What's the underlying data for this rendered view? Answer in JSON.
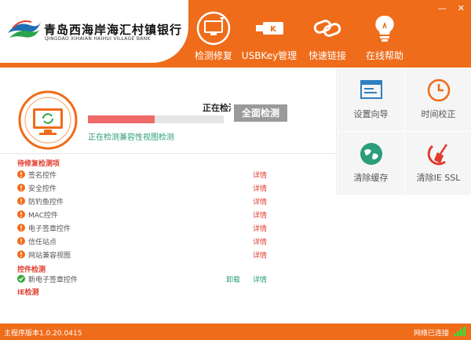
{
  "app": {
    "bank_name_cn": "青岛西海岸海汇村镇银行",
    "bank_name_en": "QINGDAO XIHAIAN HAIHUI VILLAGE BANK",
    "accent_color": "#ef6c1a"
  },
  "window_controls": {
    "minimize": "—",
    "close": "✕"
  },
  "nav": [
    {
      "label": "检测修复",
      "icon": "monitor-refresh-icon"
    },
    {
      "label": "USBKey管理",
      "icon": "usb-key-icon"
    },
    {
      "label": "快速链接",
      "icon": "link-icon"
    },
    {
      "label": "在线帮助",
      "icon": "lightbulb-icon"
    }
  ],
  "scan": {
    "title": "正在检测中",
    "button_label": "全面检测",
    "status": "正在检测兼容性视图检测",
    "progress": 0.49
  },
  "sections": {
    "pending": "待修复检测项",
    "controls": "控件检测",
    "ie": "IE检测"
  },
  "pending_items": [
    {
      "label": "签名控件",
      "action": "详情"
    },
    {
      "label": "安全控件",
      "action": "详情"
    },
    {
      "label": "防钓鱼控件",
      "action": "详情"
    },
    {
      "label": "MAC控件",
      "action": "详情"
    },
    {
      "label": "电子签章控件",
      "action": "详情"
    },
    {
      "label": "信任站点",
      "action": "详情"
    },
    {
      "label": "网站兼容视图",
      "action": "详情"
    }
  ],
  "control_items": [
    {
      "label": "新电子签章控件",
      "action_uninstall": "卸载",
      "action": "详情"
    }
  ],
  "tiles": [
    {
      "label": "设置向导",
      "icon": "setup-wizard-icon"
    },
    {
      "label": "时间校正",
      "icon": "clock-icon"
    },
    {
      "label": "清除缓存",
      "icon": "globe-clean-icon"
    },
    {
      "label": "清除IE SSL",
      "icon": "broom-icon"
    }
  ],
  "statusbar": {
    "version": "主程序版本1.0.20.0415",
    "network": "网络已连接"
  }
}
